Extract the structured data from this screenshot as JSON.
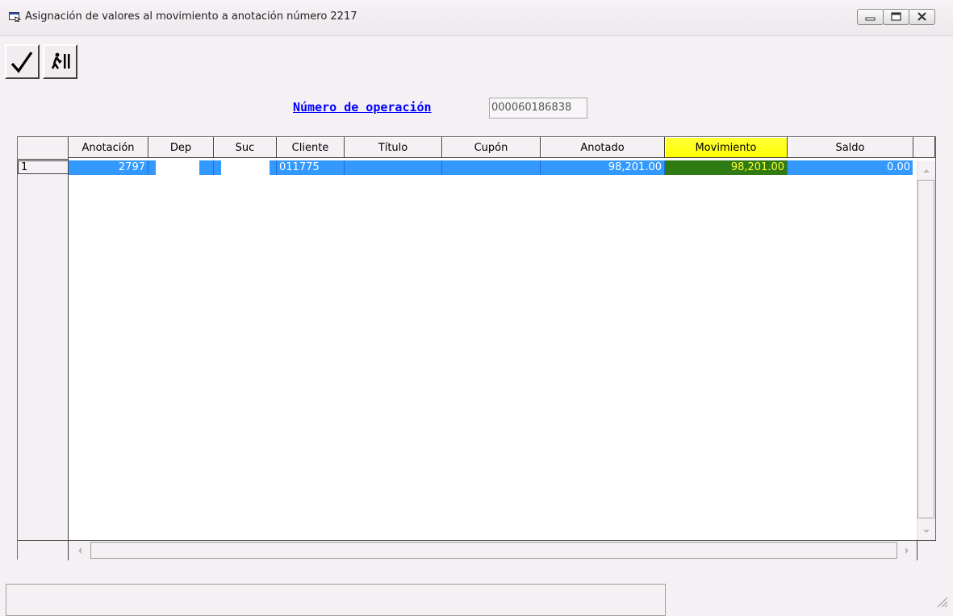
{
  "window": {
    "title": "Asignación de valores al movimiento a anotación número 2217",
    "icon": "window-app-icon",
    "controls": [
      "minimize-icon",
      "maximize-icon",
      "close-icon"
    ]
  },
  "toolbar": {
    "buttons": [
      {
        "name": "accept-button",
        "icon": "checkmark-icon"
      },
      {
        "name": "exit-button",
        "icon": "exit-person-icon"
      }
    ]
  },
  "operation": {
    "label": "Número de operación",
    "value": "000060186838"
  },
  "grid": {
    "columns": [
      "Anotación",
      "Dep",
      "Suc",
      "Cliente",
      "Título",
      "Cupón",
      "Anotado",
      "Movimiento",
      "Saldo"
    ],
    "highlighted_column": "Movimiento",
    "rows": [
      {
        "row_number": "1",
        "cells": [
          "2797",
          "",
          "",
          "011775",
          "",
          "",
          "98,201.00",
          "98,201.00",
          "0.00"
        ]
      }
    ]
  },
  "colors": {
    "selection": "#3399ff",
    "highlight_header": "#ffff00",
    "highlight_cell": "#2f7a12",
    "highlight_text": "#ffff33",
    "label_blue": "#0000ff"
  }
}
